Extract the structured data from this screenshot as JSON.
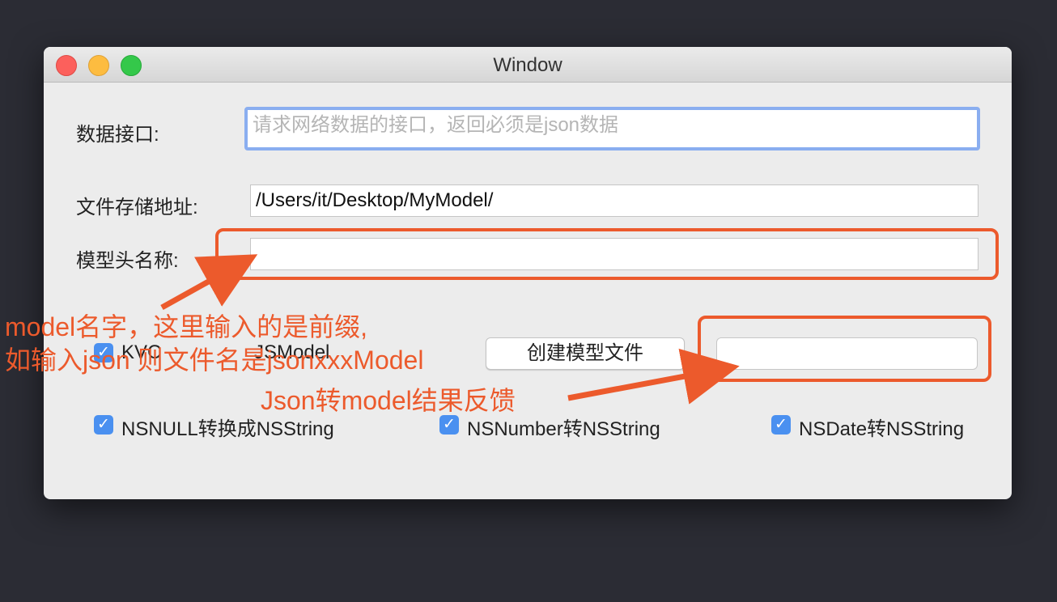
{
  "window": {
    "title": "Window"
  },
  "form": {
    "api_label": "数据接口:",
    "api_placeholder": "请求网络数据的接口，返回必须是json数据",
    "path_label": "文件存储地址:",
    "path_value": "/Users/it/Desktop/MyModel/",
    "prefix_label": "模型头名称:",
    "prefix_value": ""
  },
  "options": {
    "kvc_label": "KVC",
    "jsmodel_label": "JSModel",
    "create_button": "创建模型文件",
    "result_value": ""
  },
  "checkboxes": [
    {
      "label": "NSNULL转换成NSString",
      "checked": true
    },
    {
      "label": "NSNumber转NSString",
      "checked": true
    },
    {
      "label": "NSDate转NSString",
      "checked": true
    }
  ],
  "annotations": {
    "prefix_note_1": "model名字，这里输入的是前缀,",
    "prefix_note_2": "如输入json 则文件名是jsonxxxModel",
    "result_note": "Json转model结果反馈",
    "color": "#ec5a2c"
  }
}
